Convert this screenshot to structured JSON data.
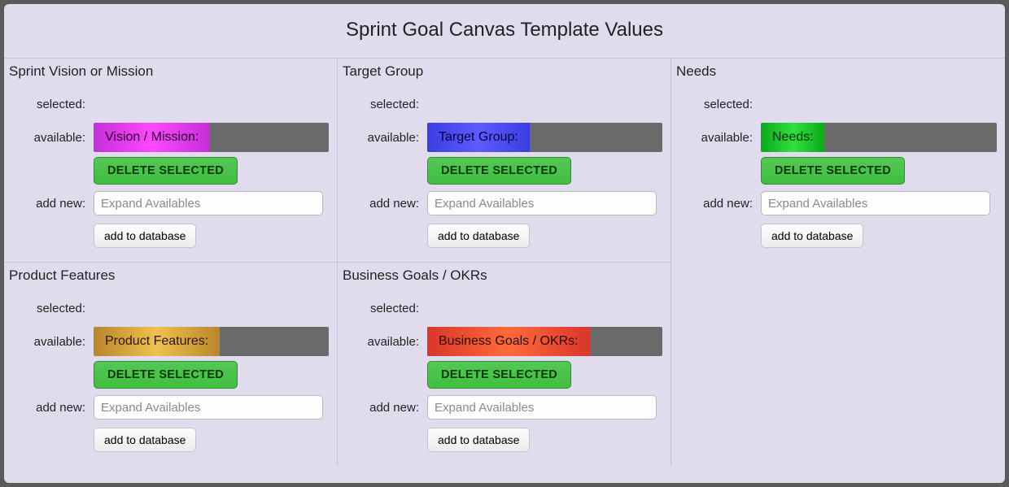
{
  "title": "Sprint Goal Canvas Template Values",
  "labels": {
    "selected": "selected:",
    "available": "available:",
    "add_new": "add new:"
  },
  "buttons": {
    "delete_selected": "DELETE SELECTED",
    "add_to_database": "add to database"
  },
  "placeholders": {
    "expand": "Expand Availables"
  },
  "sections": [
    {
      "key": "vision",
      "title": "Sprint Vision or Mission",
      "tag": "Vision / Mission:",
      "gradient": "g-vision"
    },
    {
      "key": "target",
      "title": "Target Group",
      "tag": "Target Group:",
      "gradient": "g-target"
    },
    {
      "key": "needs",
      "title": "Needs",
      "tag": "Needs:",
      "gradient": "g-needs"
    },
    {
      "key": "features",
      "title": "Product Features",
      "tag": "Product Features:",
      "gradient": "g-features"
    },
    {
      "key": "goals",
      "title": "Business Goals / OKRs",
      "tag": "Business Goals / OKRs:",
      "gradient": "g-goals"
    }
  ]
}
